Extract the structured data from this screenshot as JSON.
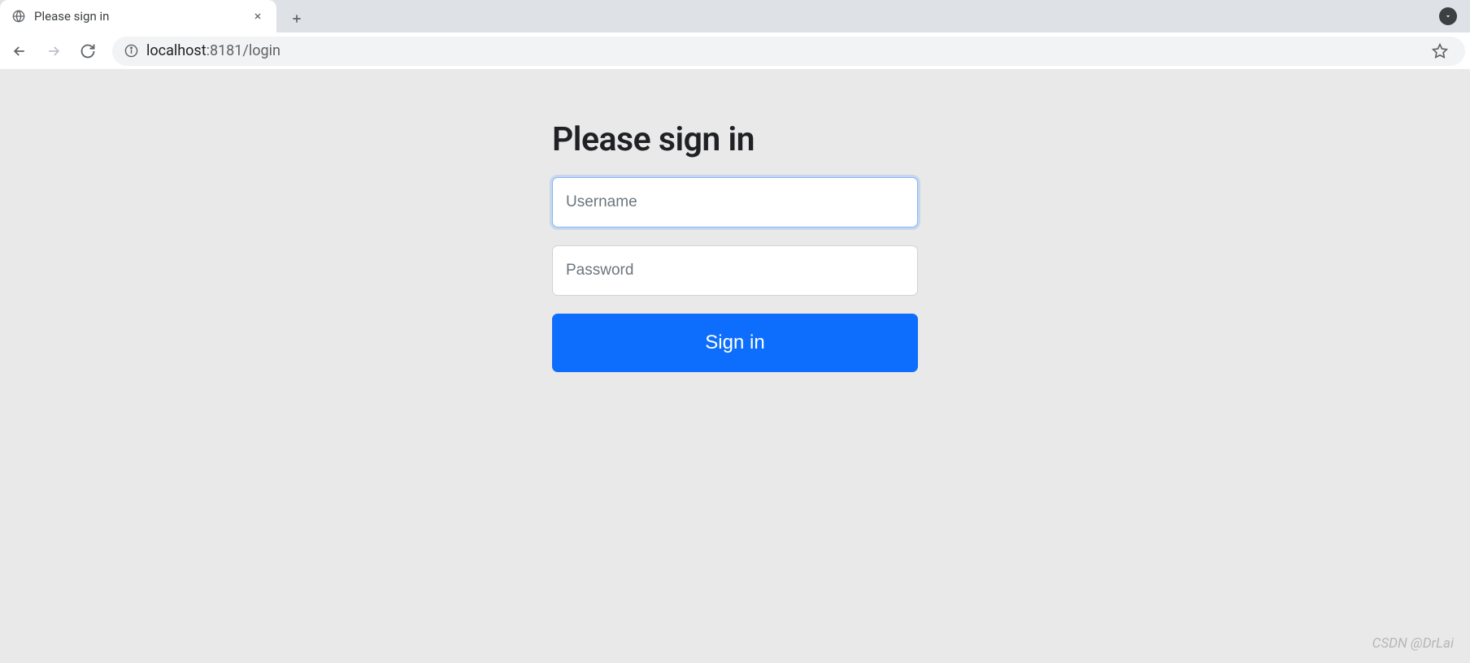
{
  "browser": {
    "tab_title": "Please sign in",
    "url_host": "localhost",
    "url_rest": ":8181/login"
  },
  "page": {
    "heading": "Please sign in",
    "username_placeholder": "Username",
    "password_placeholder": "Password",
    "signin_button": "Sign in"
  },
  "watermark": "CSDN @DrLai"
}
